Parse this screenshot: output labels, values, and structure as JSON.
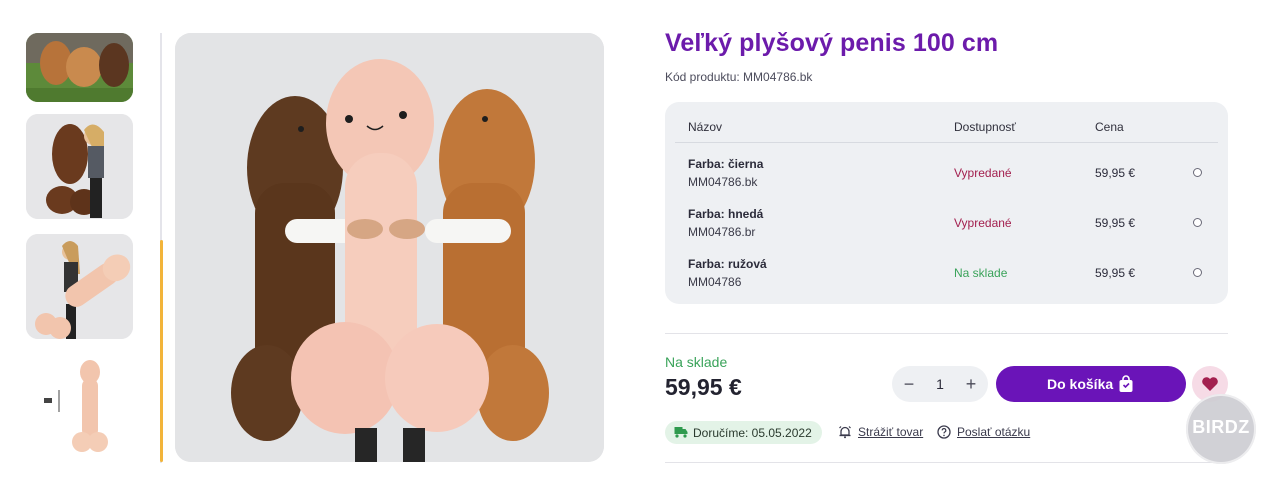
{
  "product": {
    "title": "Veľký plyšový penis 100 cm",
    "code_label": "Kód produktu: MM04786.bk"
  },
  "variants": {
    "headers": {
      "name": "Názov",
      "availability": "Dostupnosť",
      "price": "Cena"
    },
    "rows": [
      {
        "name": "Farba: čierna",
        "code": "MM04786.bk",
        "status": "Vypredané",
        "price": "59,95 €"
      },
      {
        "name": "Farba: hnedá",
        "code": "MM04786.br",
        "status": "Vypredané",
        "price": "59,95 €"
      },
      {
        "name": "Farba: ružová",
        "code": "MM04786",
        "status": "Na sklade",
        "price": "59,95 €"
      }
    ]
  },
  "purchase": {
    "stock": "Na sklade",
    "price": "59,95 €",
    "quantity": "1",
    "minus": "−",
    "plus": "+",
    "cart_label": "Do košíka"
  },
  "info": {
    "delivery": "Doručíme: 05.05.2022",
    "watch": "Strážiť tovar",
    "question": "Poslať otázku"
  },
  "watermark": "BIRDZ",
  "colors": {
    "title": "#6c1bab",
    "cart_button": "#6a14b8",
    "sold_out": "#a3204f",
    "in_stock": "#3aa35a",
    "scroll_accent": "#f2b43a"
  },
  "icons": [
    "bag-icon",
    "heart-icon",
    "truck-icon",
    "bell-icon",
    "help-circle-icon"
  ]
}
